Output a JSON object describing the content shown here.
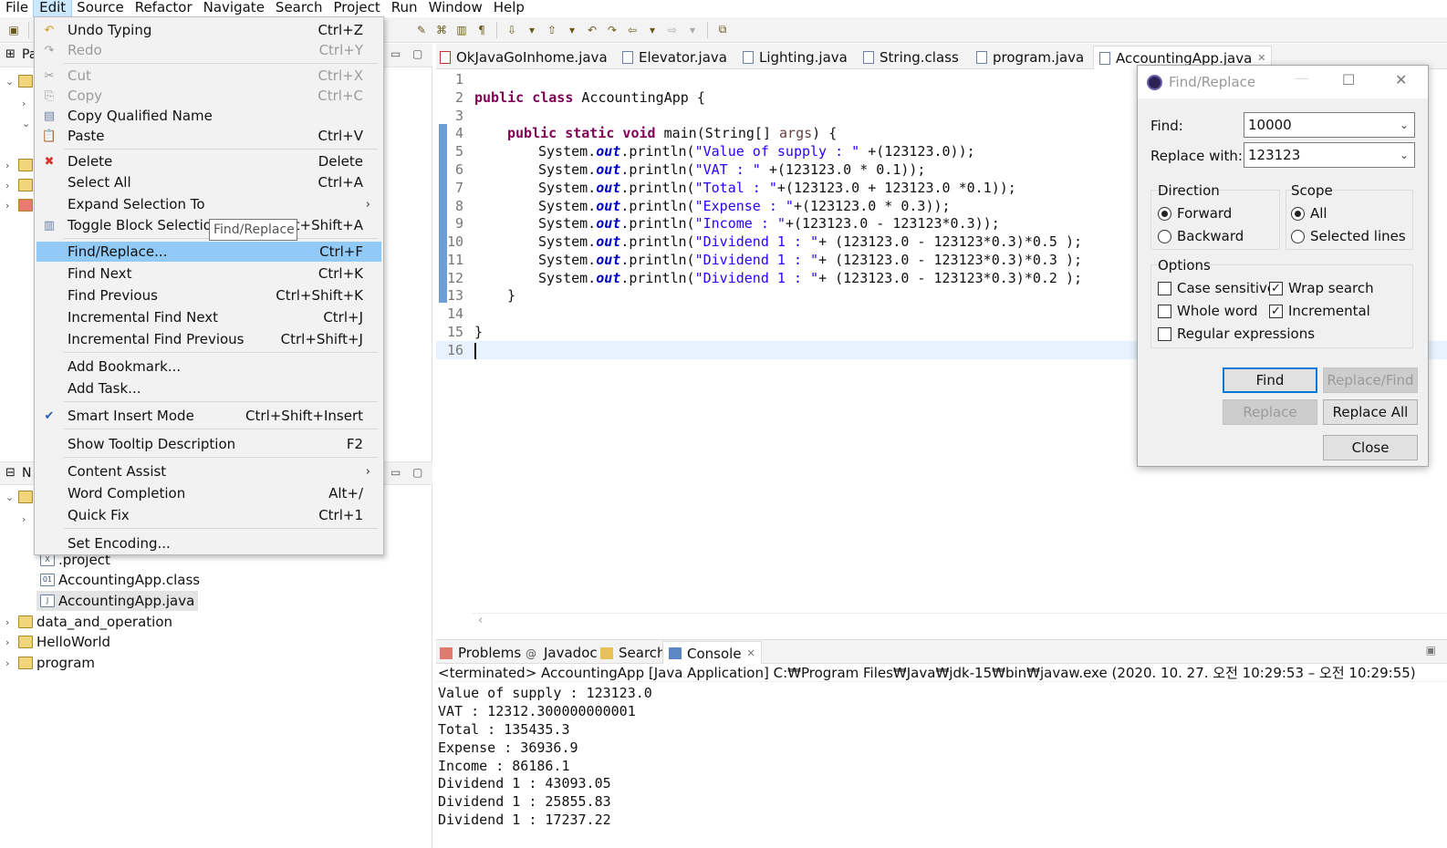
{
  "menubar": [
    "File",
    "Edit",
    "Source",
    "Refactor",
    "Navigate",
    "Search",
    "Project",
    "Run",
    "Window",
    "Help"
  ],
  "edit_menu": {
    "undo": {
      "label": "Undo Typing",
      "shortcut": "Ctrl+Z"
    },
    "redo": {
      "label": "Redo",
      "shortcut": "Ctrl+Y"
    },
    "cut": {
      "label": "Cut",
      "shortcut": "Ctrl+X"
    },
    "copy": {
      "label": "Copy",
      "shortcut": "Ctrl+C"
    },
    "copy_qualified": {
      "label": "Copy Qualified Name"
    },
    "paste": {
      "label": "Paste",
      "shortcut": "Ctrl+V"
    },
    "delete": {
      "label": "Delete",
      "shortcut": "Delete"
    },
    "select_all": {
      "label": "Select All",
      "shortcut": "Ctrl+A"
    },
    "expand_selection": {
      "label": "Expand Selection To"
    },
    "toggle_block": {
      "label": "Toggle Block Selection",
      "shortcut": "Alt+Shift+A",
      "shortcut_visible": "t+Shift+A"
    },
    "find_replace": {
      "label": "Find/Replace...",
      "shortcut": "Ctrl+F"
    },
    "find_next": {
      "label": "Find Next",
      "shortcut": "Ctrl+K"
    },
    "find_previous": {
      "label": "Find Previous",
      "shortcut": "Ctrl+Shift+K"
    },
    "inc_find_next": {
      "label": "Incremental Find Next",
      "shortcut": "Ctrl+J"
    },
    "inc_find_prev": {
      "label": "Incremental Find Previous",
      "shortcut": "Ctrl+Shift+J"
    },
    "add_bookmark": {
      "label": "Add Bookmark..."
    },
    "add_task": {
      "label": "Add Task..."
    },
    "smart_insert": {
      "label": "Smart Insert Mode",
      "shortcut": "Ctrl+Shift+Insert"
    },
    "show_tooltip": {
      "label": "Show Tooltip Description",
      "shortcut": "F2"
    },
    "content_assist": {
      "label": "Content Assist"
    },
    "word_completion": {
      "label": "Word Completion",
      "shortcut": "Alt+/"
    },
    "quick_fix": {
      "label": "Quick Fix",
      "shortcut": "Ctrl+1"
    },
    "set_encoding": {
      "label": "Set Encoding..."
    }
  },
  "tooltip": "Find/Replace",
  "explorer": {
    "top_title": "Pa",
    "bottom_title": "N",
    "files": [
      ".project",
      "AccountingApp.class",
      "AccountingApp.java"
    ],
    "projects": [
      "data_and_operation",
      "HelloWorld",
      "program"
    ]
  },
  "editor_tabs": [
    "OkJavaGoInhome.java",
    "Elevator.java",
    "Lighting.java",
    "String.class",
    "program.java",
    "AccountingApp.java"
  ],
  "code_lines": [
    "1",
    "2",
    "3",
    "4",
    "5",
    "6",
    "7",
    "8",
    "9",
    "10",
    "11",
    "12",
    "13",
    "14",
    "15",
    "16"
  ],
  "code": {
    "l2_kw": "public class",
    "l2_rest": " AccountingApp {",
    "l4_kw": "public static void",
    "l4_rest": " main(String[] ",
    "l4_param": "args",
    "l4_end": ") {",
    "sys": "System.",
    "out": "out",
    "println": ".println(",
    "l5_str": "\"Value of supply : \"",
    "l5_rest": " +(123123.0));",
    "l6_str": "\"VAT : \"",
    "l6_rest": " +(123123.0 * 0.1));",
    "l7_str": "\"Total : \"",
    "l7_rest": "+(123123.0 + 123123.0 *0.1));",
    "l8_str": "\"Expense : \"",
    "l8_rest": "+(123123.0 * 0.3));",
    "l9_str": "\"Income : \"",
    "l9_rest": "+(123123.0 - 123123*0.3));",
    "l10_str": "\"Dividend 1 : \"",
    "l10_rest": "+ (123123.0 - 123123*0.3)*0.5 );",
    "l11_str": "\"Dividend 1 : \"",
    "l11_rest": "+ (123123.0 - 123123*0.3)*0.3 );",
    "l12_str": "\"Dividend 1 : \"",
    "l12_rest": "+ (123123.0 - 123123*0.3)*0.2 );",
    "l13": "}",
    "l15": "}"
  },
  "console_tabs": [
    "Problems",
    "Javadoc",
    "Search",
    "Console"
  ],
  "console_status": "<terminated> AccountingApp [Java Application] C:₩Program Files₩Java₩jdk-15₩bin₩javaw.exe  (2020. 10. 27. 오전 10:29:53 – 오전 10:29:55)",
  "console_output": [
    "Value of supply : 123123.0",
    "VAT : 12312.300000000001",
    "Total : 135435.3",
    "Expense : 36936.9",
    "Income : 86186.1",
    "Dividend 1 : 43093.05",
    "Dividend 1 : 25855.83",
    "Dividend 1 : 17237.22"
  ],
  "find_dialog": {
    "title": "Find/Replace",
    "find_label": "Find:",
    "find_value": "10000",
    "replace_label": "Replace with:",
    "replace_value": "123123",
    "direction_title": "Direction",
    "forward": "Forward",
    "backward": "Backward",
    "scope_title": "Scope",
    "all": "All",
    "selected_lines": "Selected lines",
    "options_title": "Options",
    "case_sensitive": "Case sensitive",
    "wrap_search": "Wrap search",
    "whole_word": "Whole word",
    "incremental": "Incremental",
    "regex": "Regular expressions",
    "btn_find": "Find",
    "btn_replace_find": "Replace/Find",
    "btn_replace": "Replace",
    "btn_replace_all": "Replace All",
    "btn_close": "Close"
  },
  "colors": {
    "menu_highlight": "#91c9f7",
    "keyword": "#7f0055",
    "string": "#2a00ff",
    "field": "#0000c0"
  }
}
